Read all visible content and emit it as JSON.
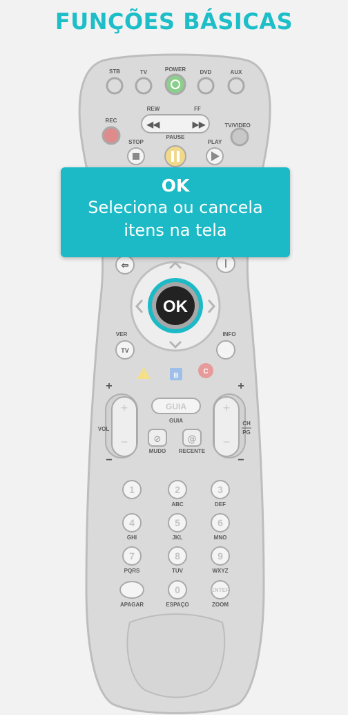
{
  "page": {
    "title": "FUNÇÕES BÁSICAS"
  },
  "tooltip": {
    "title": "OK",
    "line1": "Seleciona ou cancela",
    "line2": "itens na tela"
  },
  "remote": {
    "top": {
      "stb": "STB",
      "tv": "TV",
      "power": "POWER",
      "dvd": "DVD",
      "aux": "AUX"
    },
    "transport": {
      "rew": "REW",
      "ff": "FF",
      "rec": "REC",
      "tvvideo": "TV/VIDEO",
      "stop": "STOP",
      "pause": "PAUSE",
      "play": "PLAY"
    },
    "nav": {
      "ok": "OK",
      "ver": "VER",
      "ver_tv": "TV",
      "info": "INFO"
    },
    "colors": {
      "b": "B",
      "c": "C"
    },
    "side": {
      "plus": "+",
      "minus": "−",
      "vol": "VOL",
      "guia_button": "GUIA",
      "guia_label": "GUIA",
      "ch": "CH",
      "pg": "PG",
      "mudo": "MUDO",
      "recente": "RECENTE"
    },
    "keypad": [
      {
        "digit": "1",
        "sub": ""
      },
      {
        "digit": "2",
        "sub": "ABC"
      },
      {
        "digit": "3",
        "sub": "DEF"
      },
      {
        "digit": "4",
        "sub": "GHI"
      },
      {
        "digit": "5",
        "sub": "JKL"
      },
      {
        "digit": "6",
        "sub": "MNO"
      },
      {
        "digit": "7",
        "sub": "PQRS"
      },
      {
        "digit": "8",
        "sub": "TUV"
      },
      {
        "digit": "9",
        "sub": "WXYZ"
      },
      {
        "digit": "",
        "sub": "APAGAR"
      },
      {
        "digit": "0",
        "sub": "ESPAÇO"
      },
      {
        "digit": "ENTER",
        "sub": "ZOOM"
      }
    ]
  },
  "colors_hex": {
    "accent": "#1cbac6",
    "remote_body": "#dadada",
    "button": "#f4f4f4",
    "power": "#8ccf8c",
    "pause": "#f0d98a",
    "rec": "#e08b8b",
    "yellow": "#f4e08a",
    "blue": "#9dbfe8",
    "red": "#e79a9a",
    "ok_button": "#222222"
  }
}
